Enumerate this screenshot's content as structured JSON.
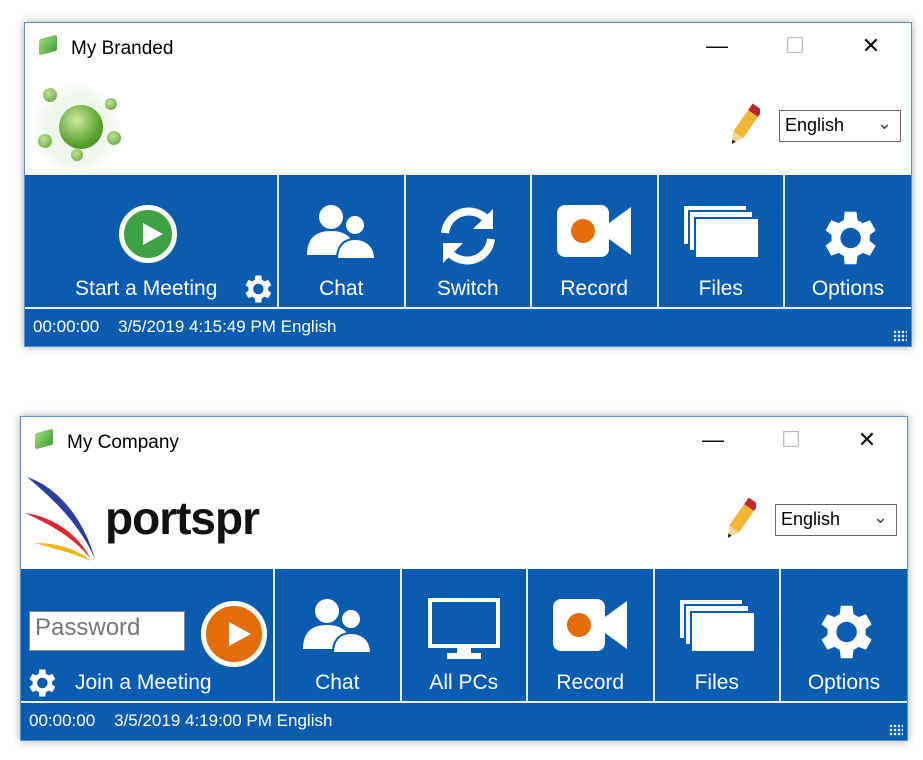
{
  "colors": {
    "toolbar": "#0a5cb0",
    "start_green": "#3ea142",
    "join_orange": "#e46c0a"
  },
  "windows": [
    {
      "title": "My Branded",
      "logo": "green-orb-logo",
      "language": "English",
      "primary": {
        "type": "start",
        "label": "Start a Meeting"
      },
      "buttons": [
        {
          "label": "Chat",
          "icon": "users-icon"
        },
        {
          "label": "Switch",
          "icon": "switch-icon"
        },
        {
          "label": "Record",
          "icon": "video-camera-icon"
        },
        {
          "label": "Files",
          "icon": "files-icon"
        },
        {
          "label": "Options",
          "icon": "gear-icon"
        }
      ],
      "status": {
        "timer": "00:00:00",
        "datetime": "3/5/2019 4:15:49 PM",
        "language": "English"
      }
    },
    {
      "title": "My Company",
      "logo": "portspr",
      "language": "English",
      "primary": {
        "type": "join",
        "label": "Join a Meeting",
        "password_placeholder": "Password"
      },
      "buttons": [
        {
          "label": "Chat",
          "icon": "users-icon"
        },
        {
          "label": "All PCs",
          "icon": "monitor-icon"
        },
        {
          "label": "Record",
          "icon": "video-camera-icon"
        },
        {
          "label": "Files",
          "icon": "files-icon"
        },
        {
          "label": "Options",
          "icon": "gear-icon"
        }
      ],
      "status": {
        "timer": "00:00:00",
        "datetime": "3/5/2019 4:19:00 PM",
        "language": "English"
      }
    }
  ]
}
